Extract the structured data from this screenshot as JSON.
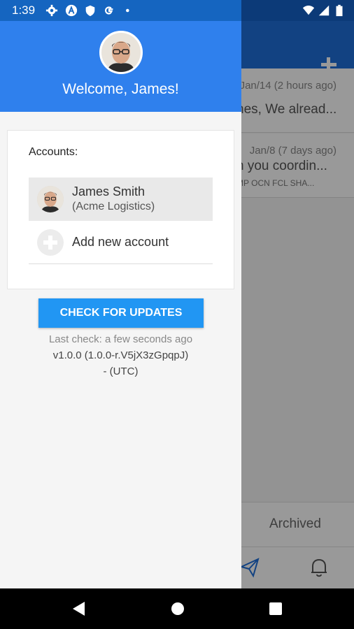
{
  "status_bar": {
    "time": "1:39",
    "icons": [
      "settings-icon",
      "app-a-icon",
      "shield-icon",
      "google-g-icon",
      "dot-icon",
      "wifi-icon",
      "signal-icon",
      "battery-icon"
    ]
  },
  "background": {
    "items": [
      {
        "date": "Jan/14 (2 hours ago)",
        "text": "nes, We alread...",
        "sub": ""
      },
      {
        "date": "Jan/8 (7 days ago)",
        "text": "n you coordin...",
        "sub": "MP OCN FCL SHA..."
      }
    ],
    "archived_tab": "Archived"
  },
  "drawer": {
    "welcome": "Welcome, James!",
    "accounts_label": "Accounts:",
    "account": {
      "name": "James Smith",
      "org": "(Acme Logistics)"
    },
    "add_account": "Add new account",
    "update_button": "CHECK FOR UPDATES",
    "last_check": "Last check: a few seconds ago",
    "version": "v1.0.0 (1.0.0-r.V5jX3zGpqpJ)",
    "version_tz": "- (UTC)"
  },
  "colors": {
    "primary": "#2f80ed",
    "button": "#2196f3",
    "status_bar": "#1565c0"
  }
}
